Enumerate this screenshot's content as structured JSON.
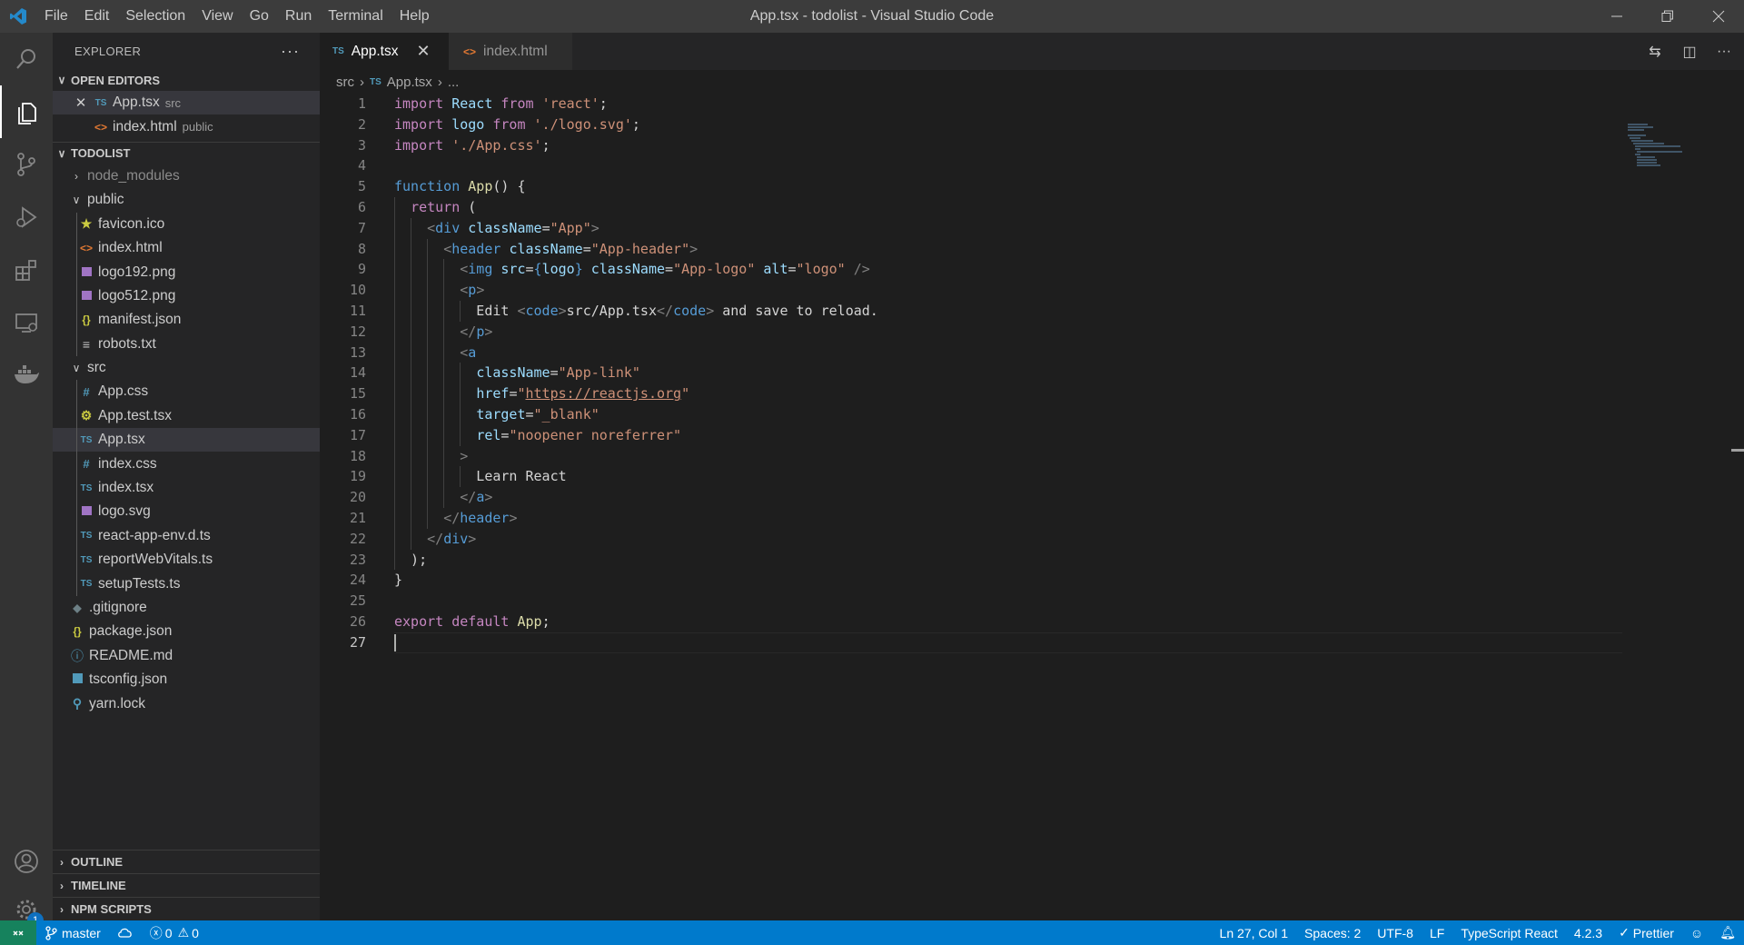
{
  "menu": [
    "File",
    "Edit",
    "Selection",
    "View",
    "Go",
    "Run",
    "Terminal",
    "Help"
  ],
  "window_title": "App.tsx - todolist - Visual Studio Code",
  "explorer_title": "EXPLORER",
  "open_editors": {
    "header": "OPEN EDITORS",
    "items": [
      {
        "icon": "TS",
        "name": "App.tsx",
        "desc": "src"
      },
      {
        "icon": "<>",
        "name": "index.html",
        "desc": "public"
      }
    ]
  },
  "project": {
    "header": "TODOLIST",
    "node_modules": "node_modules",
    "public": "public",
    "public_files": [
      "favicon.ico",
      "index.html",
      "logo192.png",
      "logo512.png",
      "manifest.json",
      "robots.txt"
    ],
    "src": "src",
    "src_files": [
      "App.css",
      "App.test.tsx",
      "App.tsx",
      "index.css",
      "index.tsx",
      "logo.svg",
      "react-app-env.d.ts",
      "reportWebVitals.ts",
      "setupTests.ts"
    ],
    "root_files": [
      ".gitignore",
      "package.json",
      "README.md",
      "tsconfig.json",
      "yarn.lock"
    ]
  },
  "bottom_sections": [
    "OUTLINE",
    "TIMELINE",
    "NPM SCRIPTS"
  ],
  "tabs": [
    {
      "icon": "TS",
      "label": "App.tsx"
    },
    {
      "icon": "<>",
      "label": "index.html"
    }
  ],
  "breadcrumb": {
    "folder": "src",
    "icon": "TS",
    "file": "App.tsx",
    "more": "..."
  },
  "code": {
    "l1": {
      "a": "import",
      "b": " React ",
      "c": "from",
      "d": " ",
      "e": "'react'",
      "f": ";"
    },
    "l2": {
      "a": "import",
      "b": " logo ",
      "c": "from",
      "d": " ",
      "e": "'./logo.svg'",
      "f": ";"
    },
    "l3": {
      "a": "import",
      "b": " ",
      "c": "'./App.css'",
      "d": ";"
    },
    "l5": {
      "a": "function",
      "b": " ",
      "c": "App",
      "d": "() {"
    },
    "l6": {
      "a": "  ",
      "b": "return",
      "c": " ("
    },
    "l7": {
      "a": "    ",
      "b": "<",
      "c": "div",
      "d": " ",
      "e": "className",
      "f": "=",
      "g": "\"App\"",
      "h": ">"
    },
    "l8": {
      "a": "      ",
      "b": "<",
      "c": "header",
      "d": " ",
      "e": "className",
      "f": "=",
      "g": "\"App-header\"",
      "h": ">"
    },
    "l9": {
      "a": "        ",
      "b": "<",
      "c": "img",
      "d": " ",
      "e": "src",
      "f": "=",
      "g": "{",
      "h": "logo",
      "i": "}",
      "j": " ",
      "k": "className",
      "l": "=",
      "m": "\"App-logo\"",
      "n": " ",
      "o": "alt",
      "p": "=",
      "q": "\"logo\"",
      "r": " />"
    },
    "l10": {
      "a": "        ",
      "b": "<",
      "c": "p",
      "d": ">"
    },
    "l11": {
      "a": "          Edit ",
      "b": "<",
      "c": "code",
      "d": ">",
      "e": "src/App.tsx",
      "f": "</",
      "g": "code",
      "h": ">",
      "i": " and save to reload."
    },
    "l12": {
      "a": "        ",
      "b": "</",
      "c": "p",
      "d": ">"
    },
    "l13": {
      "a": "        ",
      "b": "<",
      "c": "a"
    },
    "l14": {
      "a": "          ",
      "b": "className",
      "c": "=",
      "d": "\"App-link\""
    },
    "l15": {
      "a": "          ",
      "b": "href",
      "c": "=",
      "d": "\"",
      "e": "https://reactjs.org",
      "f": "\""
    },
    "l16": {
      "a": "          ",
      "b": "target",
      "c": "=",
      "d": "\"_blank\""
    },
    "l17": {
      "a": "          ",
      "b": "rel",
      "c": "=",
      "d": "\"noopener noreferrer\""
    },
    "l18": {
      "a": "        ",
      "b": ">"
    },
    "l19": {
      "a": "          Learn React"
    },
    "l20": {
      "a": "        ",
      "b": "</",
      "c": "a",
      "d": ">"
    },
    "l21": {
      "a": "      ",
      "b": "</",
      "c": "header",
      "d": ">"
    },
    "l22": {
      "a": "    ",
      "b": "</",
      "c": "div",
      "d": ">"
    },
    "l23": {
      "a": "  );"
    },
    "l24": {
      "a": "}"
    },
    "l26": {
      "a": "export",
      "b": " ",
      "c": "default",
      "d": " ",
      "e": "App",
      "f": ";"
    }
  },
  "line_numbers": [
    "1",
    "2",
    "3",
    "4",
    "5",
    "6",
    "7",
    "8",
    "9",
    "10",
    "11",
    "12",
    "13",
    "14",
    "15",
    "16",
    "17",
    "18",
    "19",
    "20",
    "21",
    "22",
    "23",
    "24",
    "25",
    "26",
    "27"
  ],
  "statusbar": {
    "branch": "master",
    "errors": "0",
    "warnings": "0",
    "position": "Ln 27, Col 1",
    "spaces": "Spaces: 2",
    "encoding": "UTF-8",
    "eol": "LF",
    "language": "TypeScript React",
    "ts_version": "4.2.3",
    "prettier": "Prettier"
  },
  "accounts_badge": "1",
  "colors": {
    "accent": "#007acc",
    "activitybar": "#333333",
    "sidebar": "#252526",
    "editor": "#1e1e1e",
    "remote": "#16825d"
  }
}
